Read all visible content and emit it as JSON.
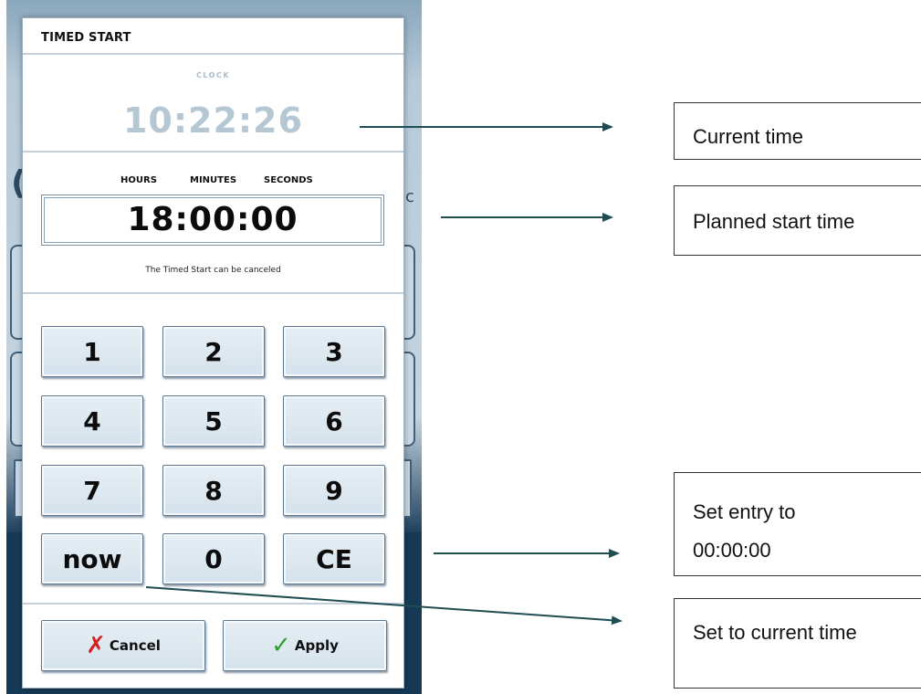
{
  "dialog": {
    "title": "TIMED START",
    "clock_label": "CLOCK",
    "clock_value": "10:22:26",
    "columns": [
      "HOURS",
      "MINUTES",
      "SECONDS"
    ],
    "planned_time": "18:00:00",
    "note": "The Timed Start can be canceled",
    "keypad": [
      "1",
      "2",
      "3",
      "4",
      "5",
      "6",
      "7",
      "8",
      "9",
      "now",
      "0",
      "CE"
    ],
    "cancel_label": "Cancel",
    "apply_label": "Apply"
  },
  "background": {
    "glyph_left": "(",
    "glyph_right": "c"
  },
  "annotations": {
    "current_time": "Current time",
    "planned_start": "Planned start time",
    "set_entry_line1": "Set entry to",
    "set_entry_line2": "00:00:00",
    "set_current": "Set to current time"
  },
  "colors": {
    "arrow": "#1f4d52",
    "cancel_icon": "#d32020",
    "apply_icon": "#2aa12a"
  }
}
